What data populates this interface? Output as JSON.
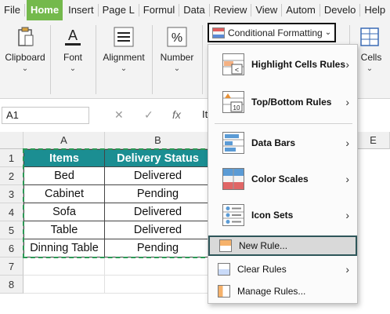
{
  "tabs": [
    {
      "label": "File"
    },
    {
      "label": "Home",
      "active": true
    },
    {
      "label": "Insert"
    },
    {
      "label": "Page L"
    },
    {
      "label": "Formul"
    },
    {
      "label": "Data"
    },
    {
      "label": "Review"
    },
    {
      "label": "View"
    },
    {
      "label": "Autom"
    },
    {
      "label": "Develo"
    },
    {
      "label": "Help"
    }
  ],
  "ribbon": {
    "clipboard": "Clipboard",
    "font": "Font",
    "alignment": "Alignment",
    "number": "Number",
    "cells": "Cells",
    "conditional_formatting": "Conditional Formatting",
    "percent_symbol": "%",
    "font_symbol": "A"
  },
  "formula_bar": {
    "name_box": "A1",
    "fx": "fx",
    "cancel": "✕",
    "confirm": "✓",
    "content": "It"
  },
  "columns": [
    "A",
    "B",
    "E"
  ],
  "rows": [
    "1",
    "2",
    "3",
    "4",
    "5",
    "6",
    "7",
    "8"
  ],
  "table": {
    "headers": [
      "Items",
      "Delivery Status"
    ],
    "rows": [
      [
        "Bed",
        "Delivered"
      ],
      [
        "Cabinet",
        "Pending"
      ],
      [
        "Sofa",
        "Delivered"
      ],
      [
        "Table",
        "Delivered"
      ],
      [
        "Dinning Table",
        "Pending"
      ]
    ]
  },
  "menu": {
    "highlight_cells_rules": "Highlight Cells Rules",
    "top_bottom_rules": "Top/Bottom Rules",
    "data_bars": "Data Bars",
    "color_scales": "Color Scales",
    "icon_sets": "Icon Sets",
    "new_rule": "New Rule...",
    "clear_rules": "Clear Rules",
    "manage_rules": "Manage Rules...",
    "icon_lt": "<",
    "icon_10": "10"
  },
  "colors": {
    "home_tab": "#74b94c",
    "table_header": "#1b8e92",
    "highlight_border": "#2e5659"
  }
}
